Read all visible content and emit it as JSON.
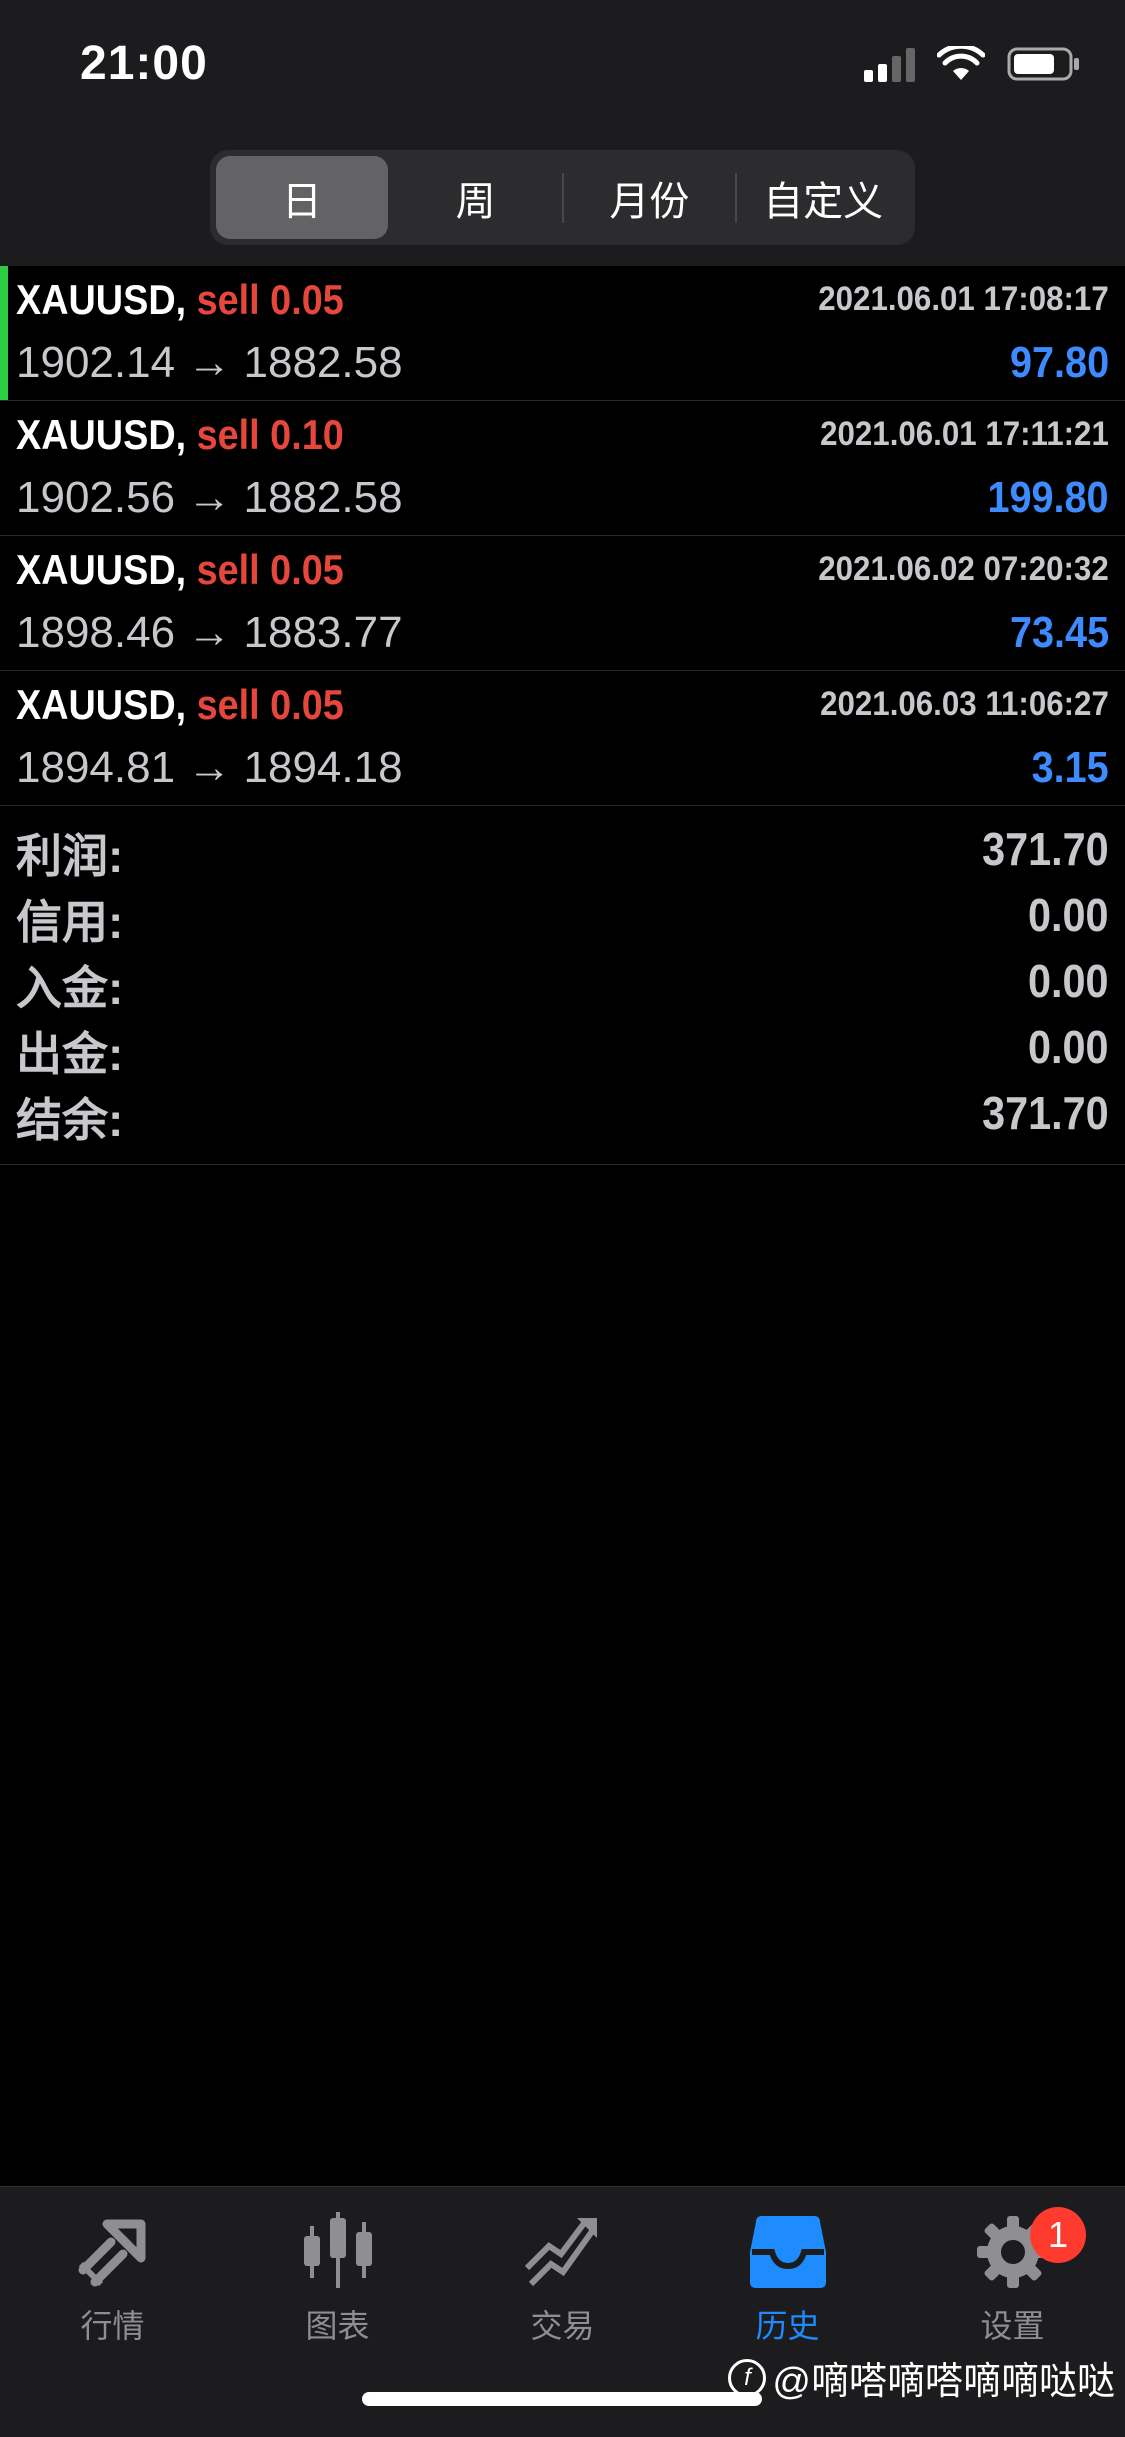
{
  "status_bar": {
    "time": "21:00"
  },
  "segments": [
    {
      "label": "日",
      "active": true
    },
    {
      "label": "周",
      "active": false
    },
    {
      "label": "月份",
      "active": false
    },
    {
      "label": "自定义",
      "active": false
    }
  ],
  "deals": [
    {
      "symbol": "XAUUSD,",
      "type": "sell 0.05",
      "time": "2021.06.01 17:08:17",
      "prices": "1902.14 → 1882.58",
      "profit": "97.80",
      "highlighted": true
    },
    {
      "symbol": "XAUUSD,",
      "type": "sell 0.10",
      "time": "2021.06.01 17:11:21",
      "prices": "1902.56 → 1882.58",
      "profit": "199.80",
      "highlighted": false
    },
    {
      "symbol": "XAUUSD,",
      "type": "sell 0.05",
      "time": "2021.06.02 07:20:32",
      "prices": "1898.46 → 1883.77",
      "profit": "73.45",
      "highlighted": false
    },
    {
      "symbol": "XAUUSD,",
      "type": "sell 0.05",
      "time": "2021.06.03 11:06:27",
      "prices": "1894.81 → 1894.18",
      "profit": "3.15",
      "highlighted": false
    }
  ],
  "summary": [
    {
      "label": "利润:",
      "value": "371.70"
    },
    {
      "label": "信用:",
      "value": "0.00"
    },
    {
      "label": "入金:",
      "value": "0.00"
    },
    {
      "label": "出金:",
      "value": "0.00"
    },
    {
      "label": "结余:",
      "value": "371.70"
    }
  ],
  "tabbar": {
    "items": [
      {
        "label": "行情",
        "icon": "quotes-icon"
      },
      {
        "label": "图表",
        "icon": "candlestick-chart-icon"
      },
      {
        "label": "交易",
        "icon": "trade-chart-icon"
      },
      {
        "label": "历史",
        "icon": "history-inbox-icon",
        "active": true
      },
      {
        "label": "设置",
        "icon": "gear-icon",
        "badge": "1"
      }
    ]
  },
  "watermark": "@嘀嗒嘀嗒嘀嘀哒哒",
  "colors": {
    "sell": "#e5473d",
    "profit": "#3d8bff",
    "active_tab": "#1e8bff",
    "highlight_bar": "#2ecc40"
  }
}
